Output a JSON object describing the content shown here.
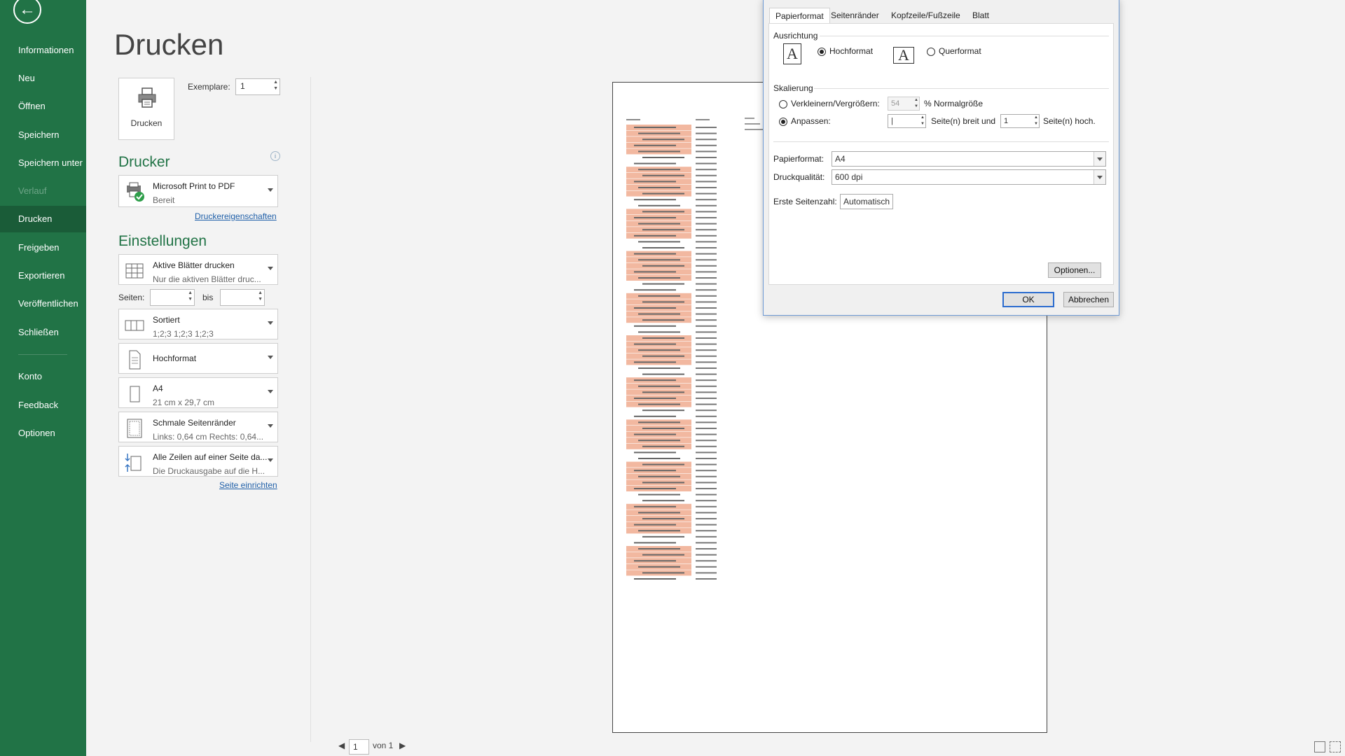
{
  "sidebar": {
    "items": [
      {
        "label": "Informationen"
      },
      {
        "label": "Neu"
      },
      {
        "label": "Öffnen"
      },
      {
        "label": "Speichern"
      },
      {
        "label": "Speichern unter"
      },
      {
        "label": "Verlauf"
      },
      {
        "label": "Drucken"
      },
      {
        "label": "Freigeben"
      },
      {
        "label": "Exportieren"
      },
      {
        "label": "Veröffentlichen"
      },
      {
        "label": "Schließen"
      },
      {
        "label": "Konto"
      },
      {
        "label": "Feedback"
      },
      {
        "label": "Optionen"
      }
    ],
    "active_label": "Drucken",
    "disabled_label": "Verlauf",
    "accent_color": "#217346"
  },
  "print": {
    "title": "Drucken",
    "print_button_label": "Drucken",
    "copies_label": "Exemplare:",
    "copies_value": "1"
  },
  "printer": {
    "heading": "Drucker",
    "name": "Microsoft Print to PDF",
    "status": "Bereit",
    "properties_link": "Druckereigenschaften"
  },
  "settings": {
    "heading": "Einstellungen",
    "what": {
      "line1": "Aktive Blätter drucken",
      "line2": "Nur die aktiven Blätter druc..."
    },
    "pages_label": "Seiten:",
    "pages_to_label": "bis",
    "collate": {
      "line1": "Sortiert",
      "line2": "1;2;3    1;2;3    1;2;3"
    },
    "orientation": {
      "line1": "Hochformat"
    },
    "paper": {
      "line1": "A4",
      "line2": "21 cm x 29,7 cm"
    },
    "margins": {
      "line1": "Schmale Seitenränder",
      "line2": "Links: 0,64 cm    Rechts: 0,64..."
    },
    "scaling": {
      "line1": "Alle Zeilen auf einer Seite da...",
      "line2": "Die Druckausgabe auf die H..."
    },
    "page_setup_link": "Seite einrichten"
  },
  "preview": {
    "page_number": "1",
    "page_of": "von 1"
  },
  "dialog": {
    "tabs": [
      "Papierformat",
      "Seitenränder",
      "Kopfzeile/Fußzeile",
      "Blatt"
    ],
    "active_tab": "Papierformat",
    "orientation_group": "Ausrichtung",
    "portrait_label": "Hochformat",
    "landscape_label": "Querformat",
    "orientation_icon_glyph": "A",
    "scaling_group": "Skalierung",
    "adjust_to_label": "Verkleinern/Vergrößern:",
    "adjust_value": "54",
    "normal_size_label": "% Normalgröße",
    "fit_to_label": "Anpassen:",
    "fit_wide_value": "|",
    "pages_wide_label": "Seite(n) breit und",
    "fit_tall_value": "1",
    "pages_tall_label": "Seite(n) hoch.",
    "paper_size_label": "Papierformat:",
    "paper_size_value": "A4",
    "print_quality_label": "Druckqualität:",
    "print_quality_value": "600 dpi",
    "first_page_label": "Erste Seitenzahl:",
    "first_page_value": "Automatisch",
    "options_button": "Optionen...",
    "ok_button": "OK",
    "cancel_button": "Abbrechen"
  }
}
